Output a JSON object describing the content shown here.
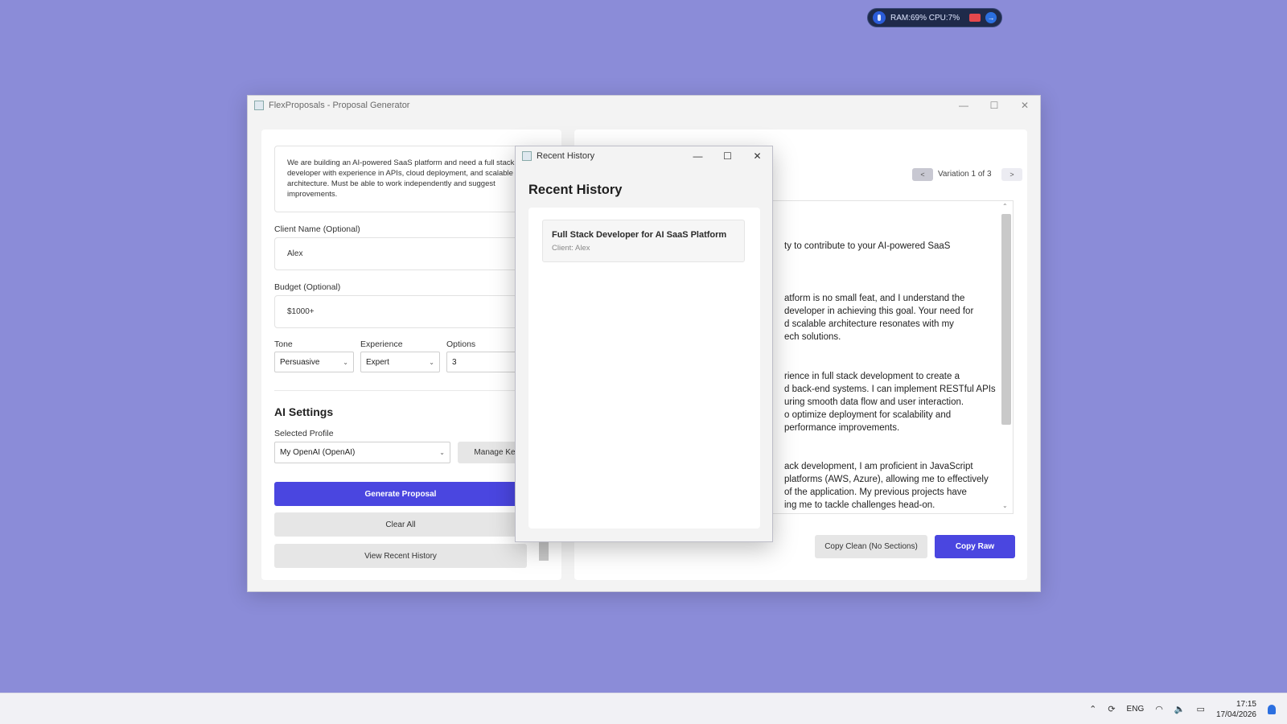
{
  "perf_widget": {
    "stats": "RAM:69%  CPU:7%"
  },
  "main_window": {
    "title": "FlexProposals - Proposal Generator",
    "left": {
      "job_description": "We are building an AI-powered SaaS platform and need a full stack developer with experience in APIs, cloud deployment, and scalable architecture. Must be able to work independently and suggest improvements.",
      "client_name_label": "Client Name (Optional)",
      "client_name_value": "Alex",
      "budget_label": "Budget (Optional)",
      "budget_value": "$1000+",
      "tone_label": "Tone",
      "tone_value": "Persuasive",
      "experience_label": "Experience",
      "experience_value": "Expert",
      "options_label": "Options",
      "options_value": "3",
      "ai_settings_title": "AI Settings",
      "profile_label": "Selected Profile",
      "profile_value": "My OpenAI (OpenAI)",
      "manage_keys": "Manage Keys",
      "generate": "Generate Proposal",
      "clear": "Clear All",
      "view_history": "View Recent History"
    },
    "right": {
      "prev": "<",
      "variation": "Variation 1 of 3",
      "next": ">",
      "proposal_lines": [
        "ty to contribute to your AI-powered SaaS",
        "atform is no small feat, and I understand the",
        "developer in achieving this goal. Your need for",
        "d scalable architecture resonates with my",
        "ech solutions.",
        "rience in full stack development to create a",
        "d back-end systems. I can implement RESTful APIs",
        "uring smooth data flow and user interaction.",
        "o optimize deployment for scalability and",
        " performance improvements.",
        "ack development, I am proficient in JavaScript",
        "platforms (AWS, Azure), allowing me to effectively",
        " of the application. My previous projects have",
        "ing me to tackle challenges head-on."
      ],
      "copy_clean": "Copy Clean (No Sections)",
      "copy_raw": "Copy Raw"
    }
  },
  "history_dialog": {
    "title": "Recent History",
    "heading": "Recent History",
    "items": [
      {
        "title": "Full Stack Developer for AI SaaS Platform",
        "client": "Client: Alex"
      }
    ]
  },
  "taskbar": {
    "lang": "ENG",
    "time": "17:15",
    "date": "17/04/2026"
  },
  "colors": {
    "accent": "#4a46e0",
    "desktop": "#8b8cd8"
  }
}
